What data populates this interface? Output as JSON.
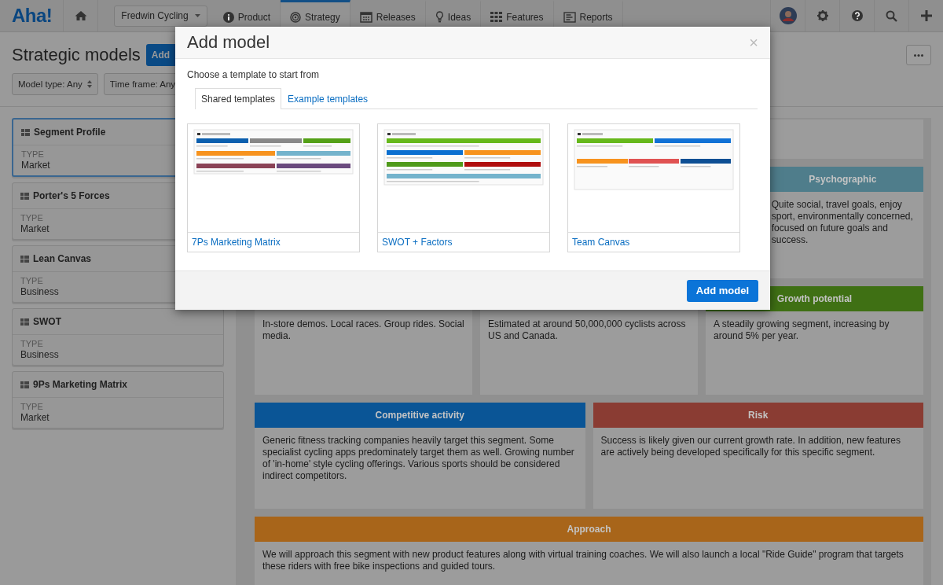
{
  "nav": {
    "logo": "Aha!",
    "workspace": "Fredwin Cycling",
    "tabs": [
      {
        "label": "Product",
        "selected": false
      },
      {
        "label": "Strategy",
        "selected": true
      },
      {
        "label": "Releases",
        "selected": false
      },
      {
        "label": "Ideas",
        "selected": false
      },
      {
        "label": "Features",
        "selected": false
      },
      {
        "label": "Reports",
        "selected": false
      }
    ]
  },
  "page": {
    "title": "Strategic models",
    "add_button": "Add",
    "filters": [
      "Model type: Any",
      "Time frame: Any"
    ]
  },
  "sidebar": {
    "items": [
      {
        "name": "Segment Profile",
        "type_label": "TYPE",
        "type": "Market",
        "selected": true
      },
      {
        "name": "Porter's 5 Forces",
        "type_label": "TYPE",
        "type": "Market",
        "selected": false
      },
      {
        "name": "Lean Canvas",
        "type_label": "TYPE",
        "type": "Business",
        "selected": false
      },
      {
        "name": "SWOT",
        "type_label": "TYPE",
        "type": "Business",
        "selected": false
      },
      {
        "name": "9Ps Marketing Matrix",
        "type_label": "TYPE",
        "type": "Market",
        "selected": false
      }
    ]
  },
  "canvas": {
    "upper": [
      {
        "kind": "blank"
      },
      {
        "kind": "card",
        "title": "Psychographic",
        "color": "#4f7d8b",
        "body": "Quite social, travel goals, enjoy sport, environmentally concerned, focused on future goals and success."
      }
    ],
    "rows": [
      [
        {
          "body": "In-store demos. Local races. Group rides. Social media."
        },
        {
          "body": "Estimated at around 50,000,000 cyclists across US and Canada."
        },
        {
          "title": "Growth potential",
          "color": "#3f7014",
          "body": "A steadily growing segment, increasing by around 5% per year."
        }
      ],
      [
        {
          "title": "Competitive activity",
          "color": "#0a5596",
          "body": "Generic fitness tracking companies heavily target this segment. Some specialist cycling apps predominately target them as well. Growing number of 'in-home' style cycling offerings. Various sports should be considered indirect competitors."
        },
        {
          "title": "Risk",
          "color": "#8a3c33",
          "body": "Success is likely given our current growth rate. In addition, new features are actively being developed specifically for this specific segment."
        }
      ],
      [
        {
          "title": "Approach",
          "color": "#a8651a",
          "body": "We will approach this segment with new product features along with virtual training coaches. We will also launch a local \"Ride Guide\" program that targets these riders with free bike inspections and guided tours."
        }
      ]
    ]
  },
  "modal": {
    "title": "Add model",
    "close": "×",
    "intro": "Choose a template to start from",
    "tabs": [
      {
        "label": "Shared templates",
        "selected": true
      },
      {
        "label": "Example templates",
        "selected": false
      }
    ],
    "templates": [
      {
        "name": "7Ps Marketing Matrix",
        "kind": "picture"
      },
      {
        "name": "SWOT + Factors",
        "kind": "picture"
      },
      {
        "name": "Team Canvas",
        "kind": "picture"
      }
    ],
    "button": "Add model"
  }
}
